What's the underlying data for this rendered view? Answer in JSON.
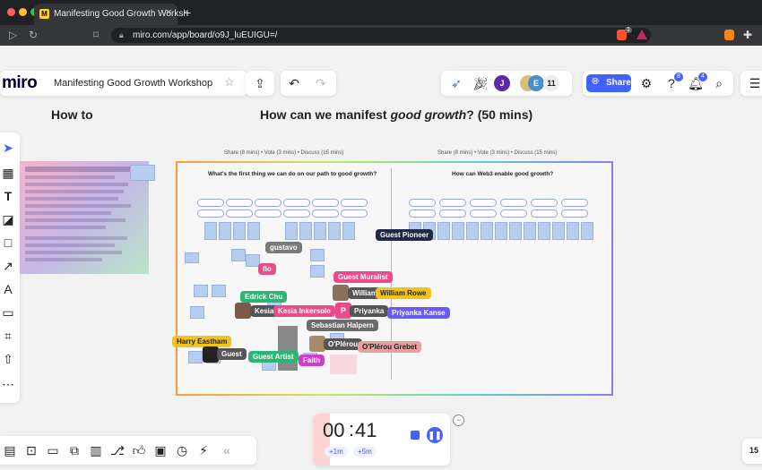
{
  "browser": {
    "tab_title": "Manifesting Good Growth Worksh",
    "favicon": "M",
    "url": "miro.com/app/board/o9J_luEUIGU=/",
    "shield_count": "1"
  },
  "toolbar": {
    "logo": "miro",
    "board_title": "Manifesting Good Growth Workshop",
    "avatar_j": "J",
    "avatar_e": "E",
    "participant_count": "11",
    "share_label": "Share",
    "notif_badge_1": "8",
    "notif_badge_2": "4"
  },
  "board": {
    "heading_left": "How to",
    "heading_main_prefix": "How can we manifest ",
    "heading_main_em": "good growth",
    "heading_main_suffix": "? (50 mins)",
    "section1_timing": "Share (8 mins) • Vote (3 mins) • Discuss (15 mins)",
    "section2_timing": "Share (8 mins) • Vote (3 mins) • Discuss (15 mins)",
    "q1": "What's the first thing we can do on our path to good growth?",
    "q2": "How can Web3 enable good growth?"
  },
  "cursors": [
    {
      "name": "gustavo",
      "color": "#7a7a7a"
    },
    {
      "name": "Guest Pioneer",
      "color": "#1f2a44"
    },
    {
      "name": "flo",
      "color": "#e94c8a"
    },
    {
      "name": "Guest Muralist",
      "color": "#e94c8a"
    },
    {
      "name": "William",
      "color": "#555555"
    },
    {
      "name": "William Rowe",
      "color": "#f0c419"
    },
    {
      "name": "Edrick Chu",
      "color": "#2bb673"
    },
    {
      "name": "Kesia",
      "color": "#555555"
    },
    {
      "name": "Kesia Inkersole",
      "color": "#e94c8a"
    },
    {
      "name": "P",
      "color": "#e94c8a"
    },
    {
      "name": "Priyanka",
      "color": "#555555"
    },
    {
      "name": "Priyanka Kanse",
      "color": "#6a5cf0"
    },
    {
      "name": "Sebastian Halpern",
      "color": "#6b6b6b"
    },
    {
      "name": "Harry Eastham",
      "color": "#f0c419"
    },
    {
      "name": "Guest",
      "color": "#555555"
    },
    {
      "name": "O'Plérou",
      "color": "#555555"
    },
    {
      "name": "O'Plérou Grebet",
      "color": "#e9a0a0"
    },
    {
      "name": "Guest Artist",
      "color": "#2bb673"
    },
    {
      "name": "Faith",
      "color": "#d23bd2"
    }
  ],
  "timer": {
    "minutes": "00",
    "seconds": "41",
    "add1": "+1m",
    "add5": "+5m"
  },
  "zoom": "15"
}
